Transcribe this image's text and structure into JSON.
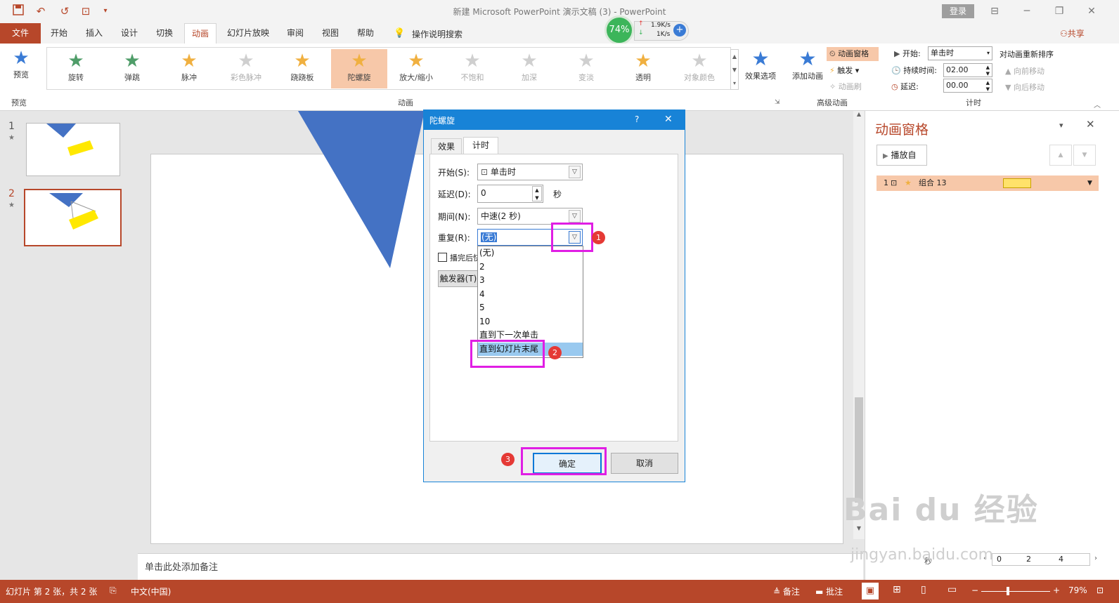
{
  "window": {
    "title": "新建 Microsoft PowerPoint 演示文稿 (3) - PowerPoint",
    "login": "登录"
  },
  "tabs": [
    "文件",
    "开始",
    "插入",
    "设计",
    "切换",
    "动画",
    "幻灯片放映",
    "审阅",
    "视图",
    "帮助"
  ],
  "tell_me": "操作说明搜索",
  "share": "共享",
  "speed_widget": {
    "percent": "74%",
    "up": "1.9K/s",
    "down": "1K/s"
  },
  "ribbon": {
    "preview_label": "预览",
    "preview_group": "预览",
    "animations": [
      {
        "label": "旋转",
        "color": "#4f9d69",
        "disabled": false
      },
      {
        "label": "弹跳",
        "color": "#4f9d69",
        "disabled": false
      },
      {
        "label": "脉冲",
        "color": "#f0b040",
        "disabled": false
      },
      {
        "label": "彩色脉冲",
        "color": "#cfcfcf",
        "disabled": true
      },
      {
        "label": "跷跷板",
        "color": "#f0b040",
        "disabled": false
      },
      {
        "label": "陀螺旋",
        "color": "#f0b040",
        "disabled": false,
        "selected": true
      },
      {
        "label": "放大/缩小",
        "color": "#f0b040",
        "disabled": false
      },
      {
        "label": "不饱和",
        "color": "#cfcfcf",
        "disabled": true
      },
      {
        "label": "加深",
        "color": "#cfcfcf",
        "disabled": true
      },
      {
        "label": "变淡",
        "color": "#cfcfcf",
        "disabled": true
      },
      {
        "label": "透明",
        "color": "#f0b040",
        "disabled": false
      },
      {
        "label": "对象颜色",
        "color": "#cfcfcf",
        "disabled": true
      }
    ],
    "animation_group": "动画",
    "effect_options": "效果选项",
    "add_animation": "添加动画",
    "anim_pane_btn": "动画窗格",
    "trigger": "触发",
    "anim_painter": "动画刷",
    "advanced_group": "高级动画",
    "start_label": "开始:",
    "start_value": "单击时",
    "duration_label": "持续时间:",
    "duration_value": "02.00",
    "delay_label": "延迟:",
    "delay_value": "00.00",
    "reorder": "对动画重新排序",
    "move_earlier": "向前移动",
    "move_later": "向后移动",
    "timing_group": "计时"
  },
  "slides": [
    {
      "num": "1"
    },
    {
      "num": "2"
    }
  ],
  "notes_placeholder": "单击此处添加备注",
  "anim_pane": {
    "title": "动画窗格",
    "play_btn": "播放自",
    "item_num": "1",
    "item_label": "组合 13",
    "item_color": "#ffe26a",
    "seconds": "秒",
    "timeline": [
      "0",
      "2",
      "4"
    ]
  },
  "dialog": {
    "title": "陀螺旋",
    "help": "?",
    "close": "✕",
    "tabs": [
      "效果",
      "计时"
    ],
    "start_label": "开始(S):",
    "start_value": "单击时",
    "delay_label": "延迟(D):",
    "delay_value": "0",
    "delay_unit": "秒",
    "period_label": "期间(N):",
    "period_value": "中速(2 秒)",
    "repeat_label": "重复(R):",
    "repeat_value": "(无)",
    "rewind_label": "播完后快退",
    "trigger_btn": "触发器(T)",
    "repeat_options": [
      "(无)",
      "2",
      "3",
      "4",
      "5",
      "10",
      "直到下一次单击",
      "直到幻灯片末尾"
    ],
    "ok": "确定",
    "cancel": "取消"
  },
  "badges": [
    "1",
    "2",
    "3"
  ],
  "status": {
    "slide_info": "幻灯片 第 2 张，共 2 张",
    "language": "中文(中国)",
    "notes": "备注",
    "comments": "批注",
    "zoom": "79%"
  },
  "watermark": {
    "logo": "Bai du 经验",
    "url": "jingyan.baidu.com"
  }
}
